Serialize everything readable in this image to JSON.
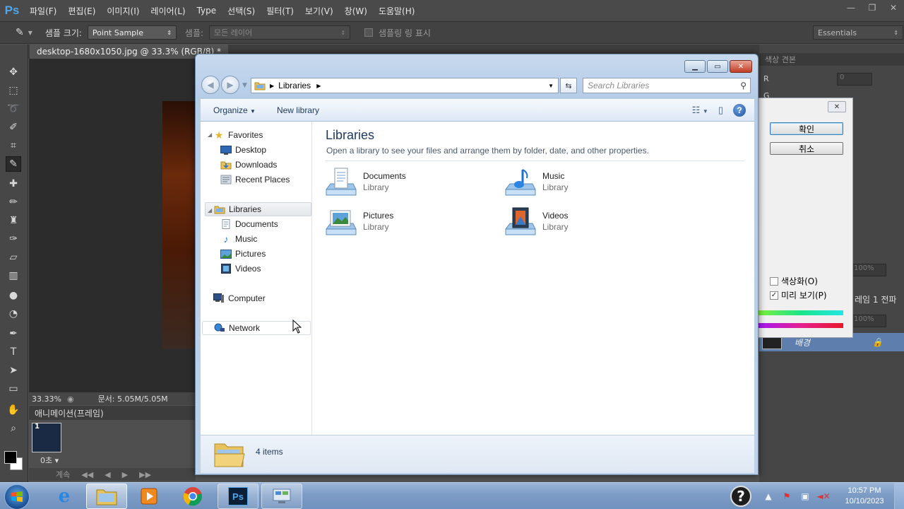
{
  "photoshop": {
    "logo": "Ps",
    "menus": [
      "파일(F)",
      "편집(E)",
      "이미지(I)",
      "레이어(L)",
      "Type",
      "선택(S)",
      "필터(T)",
      "보기(V)",
      "창(W)",
      "도움말(H)"
    ],
    "options": {
      "sample_size_label": "샘플 크기:",
      "sample_size_value": "Point Sample",
      "sample_label": "샘플:",
      "sample_value": "모든 레이어",
      "show_ring_label": "샘플링 링 표시",
      "workspace": "Essentials"
    },
    "document_tab": "desktop-1680x1050.jpg @ 33.3% (RGB/8) *",
    "status": {
      "zoom": "33.33%",
      "doc_size": "문서: 5.05M/5.05M"
    },
    "animation": {
      "header": "애니메이션(프레임)",
      "frame_number": "1",
      "frame_time": "0초 ▾",
      "loop_label": "계속"
    },
    "right_panel": {
      "tab_label": "색상 견본",
      "r_label": "R",
      "g_label": "G",
      "r_value": "0",
      "opacity_1": "100%",
      "opacity_2": "100%",
      "layer_side_text": "레임 1 전파",
      "layer_name": "배경"
    }
  },
  "korean_dialog": {
    "ok_label": "확인",
    "cancel_label": "취소",
    "colorize_label": "색상화(O)",
    "colorize_checked": false,
    "preview_label": "미리 보기(P)",
    "preview_checked": true
  },
  "explorer": {
    "address_label": "Libraries",
    "search_placeholder": "Search Libraries",
    "toolbar": {
      "organize": "Organize",
      "new_library": "New library"
    },
    "nav": {
      "favorites": "Favorites",
      "desktop": "Desktop",
      "downloads": "Downloads",
      "recent_places": "Recent Places",
      "libraries": "Libraries",
      "documents": "Documents",
      "music": "Music",
      "pictures": "Pictures",
      "videos": "Videos",
      "computer": "Computer",
      "network": "Network"
    },
    "content": {
      "title": "Libraries",
      "description": "Open a library to see your files and arrange them by folder, date, and other properties.",
      "items": [
        {
          "name": "Documents",
          "type": "Library",
          "icon": "documents-library-icon"
        },
        {
          "name": "Music",
          "type": "Library",
          "icon": "music-library-icon"
        },
        {
          "name": "Pictures",
          "type": "Library",
          "icon": "pictures-library-icon"
        },
        {
          "name": "Videos",
          "type": "Library",
          "icon": "videos-library-icon"
        }
      ]
    },
    "details": {
      "count": "4 items"
    }
  },
  "taskbar": {
    "apps": [
      "internet-explorer-icon",
      "windows-explorer-icon",
      "media-player-icon",
      "chrome-icon",
      "photoshop-icon",
      "control-panel-icon"
    ],
    "ps_label": "Ps",
    "clock_time": "10:57 PM",
    "clock_date": "10/10/2023"
  },
  "colors": {
    "ps_bg": "#535353",
    "explorer_frame": "#bcd2ea",
    "explorer_title_text": "#1e395b",
    "taskbar": "#7d9cc6"
  }
}
